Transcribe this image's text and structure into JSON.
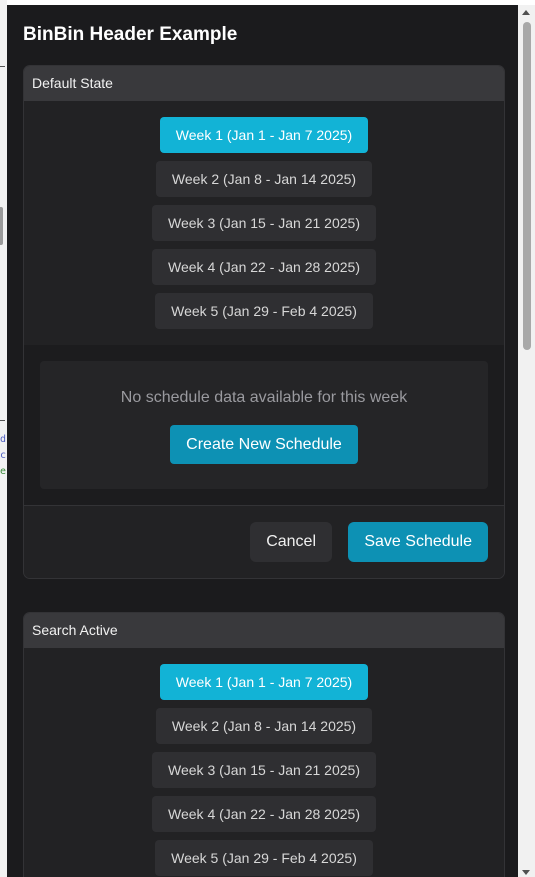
{
  "title": "BinBin Header Example",
  "cards": [
    {
      "header": "Default State",
      "weeks": [
        "Week 1 (Jan 1 - Jan 7 2025)",
        "Week 2 (Jan 8 - Jan 14 2025)",
        "Week 3 (Jan 15 - Jan 21 2025)",
        "Week 4 (Jan 22 - Jan 28 2025)",
        "Week 5 (Jan 29 - Feb 4 2025)"
      ],
      "active_week": 0,
      "empty_text": "No schedule data available for this week",
      "create_label": "Create New Schedule",
      "cancel_label": "Cancel",
      "save_label": "Save Schedule"
    },
    {
      "header": "Search Active",
      "weeks": [
        "Week 1 (Jan 1 - Jan 7 2025)",
        "Week 2 (Jan 8 - Jan 14 2025)",
        "Week 3 (Jan 15 - Jan 21 2025)",
        "Week 4 (Jan 22 - Jan 28 2025)",
        "Week 5 (Jan 29 - Feb 4 2025)"
      ],
      "active_week": 0
    }
  ],
  "left_strip_chars": [
    "d",
    "c",
    "e"
  ],
  "colors": {
    "accent": "#12b3d6",
    "primary_button": "#0d91b4",
    "background": "#1b1b1d",
    "card": "#222224"
  }
}
